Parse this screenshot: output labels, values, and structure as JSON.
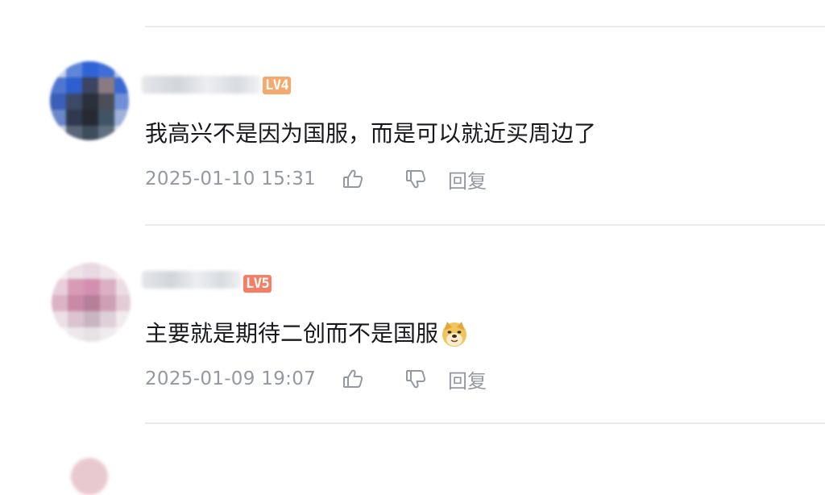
{
  "comments": [
    {
      "level_label": "LV4",
      "level_color": "#f6a96c",
      "text": "我高兴不是因为国服，而是可以就近买周边了",
      "time": "2025-01-10 15:31",
      "reply_label": "回复",
      "emoji": ""
    },
    {
      "level_label": "LV5",
      "level_color": "#f57e65",
      "text": "主要就是期待二创而不是国服",
      "time": "2025-01-09 19:07",
      "reply_label": "回复",
      "emoji": "doge"
    }
  ],
  "colors": {
    "divider": "#e9eaec",
    "meta_text": "#9499a0",
    "body_text": "#18191c"
  },
  "icons": [
    "thumbs-up-icon",
    "thumbs-down-icon",
    "doge-emoji"
  ]
}
